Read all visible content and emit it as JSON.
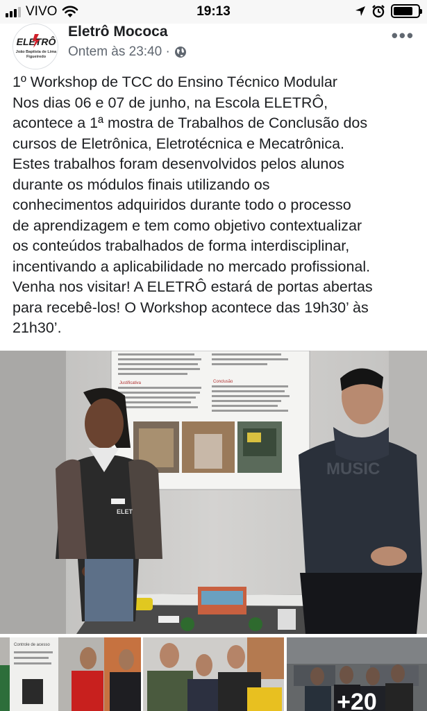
{
  "status_bar": {
    "carrier": "VIVO",
    "time": "19:13"
  },
  "post": {
    "author": "Eletrô Mococa",
    "timestamp": "Ontem às 23:40 ·",
    "privacy_icon": "globe-icon",
    "logo_text": "ELETRÔ",
    "logo_subtext_1": "João Baptista de Lima",
    "logo_subtext_2": "Figueiredo",
    "text_lines": [
      "1º Workshop de TCC do Ensino Técnico Modular",
      "Nos dias 06 e 07 de junho, na Escola ELETRÔ,",
      "acontece a 1ª mostra de Trabalhos de Conclusão dos",
      "cursos de Eletrônica, Eletrotécnica e Mecatrônica.",
      "Estes trabalhos foram desenvolvidos pelos alunos",
      "durante os módulos finais utilizando os",
      "conhecimentos adquiridos durante todo o processo",
      "de aprendizagem e tem como objetivo contextualizar",
      "os conteúdos trabalhados de forma interdisciplinar,",
      "incentivando a aplicabilidade no mercado profissional.",
      "Venha nos visitar! A ELETRÔ estará de portas abertas",
      "para recebê-los! O Workshop acontece das 19h30’ às",
      "21h30’."
    ]
  },
  "photos": {
    "main_shirt_text": "MUSIC",
    "main_badge_text": "ELET",
    "poster_heading_left": "Justificativa",
    "poster_heading_right": "Conclusão",
    "thumb1_poster_title": "Controle de acesso",
    "thumb3_more_count": "+20"
  },
  "colors": {
    "text": "#1c1e21",
    "meta": "#606770",
    "logo_red": "#d0202b"
  }
}
